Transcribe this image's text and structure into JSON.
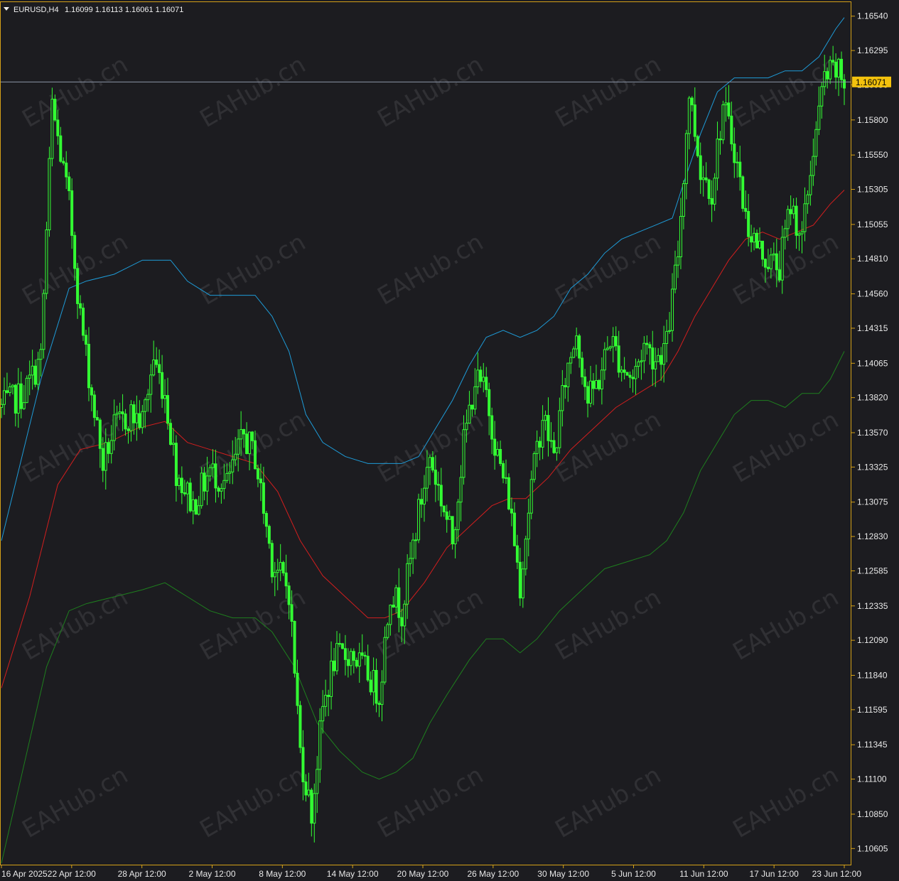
{
  "header": {
    "symbol": "EURUSD,H4",
    "ohlc": "1.16099 1.16113 1.16061 1.16071"
  },
  "current_price_label": "1.16071",
  "watermark_text": "EAHub.cn",
  "colors": {
    "background": "#1c1c20",
    "frame": "#d4a017",
    "candle": "#33ff33",
    "upper_band": "#1e9bd7",
    "middle_band": "#d21e1e",
    "lower_band": "#1e7f1e",
    "price_line": "#8a94a6",
    "price_tag": "#f4c20d"
  },
  "chart_data": {
    "type": "candlestick",
    "symbol": "EURUSD",
    "timeframe": "H4",
    "ylim": [
      1.1049,
      1.1664
    ],
    "y_ticks": [
      "1.16540",
      "1.16295",
      "1.16050",
      "1.15800",
      "1.15550",
      "1.15305",
      "1.15055",
      "1.14810",
      "1.14560",
      "1.14315",
      "1.14065",
      "1.13820",
      "1.13570",
      "1.13325",
      "1.13075",
      "1.12830",
      "1.12585",
      "1.12335",
      "1.12090",
      "1.11840",
      "1.11595",
      "1.11345",
      "1.11100",
      "1.10850",
      "1.10605"
    ],
    "x_ticks": [
      "16 Apr 2025",
      "22 Apr 12:00",
      "28 Apr 12:00",
      "2 May 12:00",
      "8 May 12:00",
      "14 May 12:00",
      "20 May 12:00",
      "26 May 12:00",
      "30 May 12:00",
      "5 Jun 12:00",
      "11 Jun 12:00",
      "17 Jun 12:00",
      "23 Jun 12:00"
    ],
    "current_price": 1.16071,
    "close_path": [
      {
        "bar": 0,
        "price": 1.1375
      },
      {
        "bar": 8,
        "price": 1.1385
      },
      {
        "bar": 14,
        "price": 1.141
      },
      {
        "bar": 18,
        "price": 1.159
      },
      {
        "bar": 24,
        "price": 1.152
      },
      {
        "bar": 28,
        "price": 1.144
      },
      {
        "bar": 32,
        "price": 1.1385
      },
      {
        "bar": 36,
        "price": 1.1335
      },
      {
        "bar": 40,
        "price": 1.136
      },
      {
        "bar": 46,
        "price": 1.137
      },
      {
        "bar": 50,
        "price": 1.1365
      },
      {
        "bar": 54,
        "price": 1.141
      },
      {
        "bar": 58,
        "price": 1.1385
      },
      {
        "bar": 62,
        "price": 1.133
      },
      {
        "bar": 68,
        "price": 1.1305
      },
      {
        "bar": 74,
        "price": 1.133
      },
      {
        "bar": 80,
        "price": 1.132
      },
      {
        "bar": 86,
        "price": 1.1355
      },
      {
        "bar": 90,
        "price": 1.134
      },
      {
        "bar": 96,
        "price": 1.1265
      },
      {
        "bar": 102,
        "price": 1.1245
      },
      {
        "bar": 106,
        "price": 1.113
      },
      {
        "bar": 110,
        "price": 1.1085
      },
      {
        "bar": 114,
        "price": 1.116
      },
      {
        "bar": 118,
        "price": 1.1195
      },
      {
        "bar": 124,
        "price": 1.12
      },
      {
        "bar": 130,
        "price": 1.1185
      },
      {
        "bar": 134,
        "price": 1.117
      },
      {
        "bar": 138,
        "price": 1.1245
      },
      {
        "bar": 142,
        "price": 1.123
      },
      {
        "bar": 148,
        "price": 1.13
      },
      {
        "bar": 152,
        "price": 1.134
      },
      {
        "bar": 156,
        "price": 1.131
      },
      {
        "bar": 160,
        "price": 1.128
      },
      {
        "bar": 164,
        "price": 1.135
      },
      {
        "bar": 168,
        "price": 1.1395
      },
      {
        "bar": 172,
        "price": 1.1385
      },
      {
        "bar": 176,
        "price": 1.134
      },
      {
        "bar": 180,
        "price": 1.131
      },
      {
        "bar": 184,
        "price": 1.125
      },
      {
        "bar": 188,
        "price": 1.132
      },
      {
        "bar": 192,
        "price": 1.137
      },
      {
        "bar": 196,
        "price": 1.134
      },
      {
        "bar": 200,
        "price": 1.1395
      },
      {
        "bar": 204,
        "price": 1.143
      },
      {
        "bar": 208,
        "price": 1.138
      },
      {
        "bar": 212,
        "price": 1.1395
      },
      {
        "bar": 216,
        "price": 1.1425
      },
      {
        "bar": 220,
        "price": 1.1405
      },
      {
        "bar": 224,
        "price": 1.1395
      },
      {
        "bar": 228,
        "price": 1.142
      },
      {
        "bar": 232,
        "price": 1.141
      },
      {
        "bar": 236,
        "price": 1.142
      },
      {
        "bar": 240,
        "price": 1.1485
      },
      {
        "bar": 244,
        "price": 1.16
      },
      {
        "bar": 248,
        "price": 1.1545
      },
      {
        "bar": 252,
        "price": 1.153
      },
      {
        "bar": 256,
        "price": 1.159
      },
      {
        "bar": 260,
        "price": 1.156
      },
      {
        "bar": 264,
        "price": 1.151
      },
      {
        "bar": 268,
        "price": 1.149
      },
      {
        "bar": 272,
        "price": 1.148
      },
      {
        "bar": 276,
        "price": 1.1475
      },
      {
        "bar": 280,
        "price": 1.152
      },
      {
        "bar": 284,
        "price": 1.1495
      },
      {
        "bar": 288,
        "price": 1.156
      },
      {
        "bar": 292,
        "price": 1.161
      },
      {
        "bar": 296,
        "price": 1.1615
      },
      {
        "bar": 299,
        "price": 1.16071
      }
    ],
    "upper_band": [
      {
        "bar": 0,
        "price": 1.128
      },
      {
        "bar": 14,
        "price": 1.1395
      },
      {
        "bar": 24,
        "price": 1.146
      },
      {
        "bar": 30,
        "price": 1.1465
      },
      {
        "bar": 40,
        "price": 1.147
      },
      {
        "bar": 50,
        "price": 1.148
      },
      {
        "bar": 60,
        "price": 1.148
      },
      {
        "bar": 66,
        "price": 1.1465
      },
      {
        "bar": 74,
        "price": 1.1455
      },
      {
        "bar": 82,
        "price": 1.1455
      },
      {
        "bar": 90,
        "price": 1.1455
      },
      {
        "bar": 96,
        "price": 1.144
      },
      {
        "bar": 102,
        "price": 1.1415
      },
      {
        "bar": 108,
        "price": 1.137
      },
      {
        "bar": 114,
        "price": 1.135
      },
      {
        "bar": 122,
        "price": 1.134
      },
      {
        "bar": 130,
        "price": 1.1335
      },
      {
        "bar": 136,
        "price": 1.1335
      },
      {
        "bar": 142,
        "price": 1.1335
      },
      {
        "bar": 148,
        "price": 1.134
      },
      {
        "bar": 154,
        "price": 1.136
      },
      {
        "bar": 160,
        "price": 1.138
      },
      {
        "bar": 166,
        "price": 1.1405
      },
      {
        "bar": 172,
        "price": 1.1425
      },
      {
        "bar": 178,
        "price": 1.143
      },
      {
        "bar": 184,
        "price": 1.1425
      },
      {
        "bar": 190,
        "price": 1.143
      },
      {
        "bar": 196,
        "price": 1.144
      },
      {
        "bar": 202,
        "price": 1.146
      },
      {
        "bar": 208,
        "price": 1.147
      },
      {
        "bar": 214,
        "price": 1.1485
      },
      {
        "bar": 220,
        "price": 1.1495
      },
      {
        "bar": 226,
        "price": 1.15
      },
      {
        "bar": 232,
        "price": 1.1505
      },
      {
        "bar": 238,
        "price": 1.151
      },
      {
        "bar": 242,
        "price": 1.1535
      },
      {
        "bar": 248,
        "price": 1.157
      },
      {
        "bar": 254,
        "price": 1.16
      },
      {
        "bar": 260,
        "price": 1.161
      },
      {
        "bar": 266,
        "price": 1.161
      },
      {
        "bar": 272,
        "price": 1.161
      },
      {
        "bar": 278,
        "price": 1.1615
      },
      {
        "bar": 284,
        "price": 1.1615
      },
      {
        "bar": 290,
        "price": 1.1625
      },
      {
        "bar": 296,
        "price": 1.1645
      },
      {
        "bar": 299,
        "price": 1.1653
      }
    ],
    "middle_band": [
      {
        "bar": 0,
        "price": 1.1175
      },
      {
        "bar": 10,
        "price": 1.124
      },
      {
        "bar": 20,
        "price": 1.132
      },
      {
        "bar": 28,
        "price": 1.1345
      },
      {
        "bar": 38,
        "price": 1.135
      },
      {
        "bar": 48,
        "price": 1.136
      },
      {
        "bar": 58,
        "price": 1.1365
      },
      {
        "bar": 66,
        "price": 1.135
      },
      {
        "bar": 74,
        "price": 1.1345
      },
      {
        "bar": 82,
        "price": 1.134
      },
      {
        "bar": 90,
        "price": 1.1335
      },
      {
        "bar": 98,
        "price": 1.1315
      },
      {
        "bar": 106,
        "price": 1.128
      },
      {
        "bar": 114,
        "price": 1.1255
      },
      {
        "bar": 122,
        "price": 1.124
      },
      {
        "bar": 130,
        "price": 1.1225
      },
      {
        "bar": 136,
        "price": 1.1225
      },
      {
        "bar": 142,
        "price": 1.123
      },
      {
        "bar": 150,
        "price": 1.125
      },
      {
        "bar": 158,
        "price": 1.1275
      },
      {
        "bar": 166,
        "price": 1.129
      },
      {
        "bar": 174,
        "price": 1.1305
      },
      {
        "bar": 180,
        "price": 1.131
      },
      {
        "bar": 186,
        "price": 1.131
      },
      {
        "bar": 194,
        "price": 1.1325
      },
      {
        "bar": 202,
        "price": 1.1345
      },
      {
        "bar": 210,
        "price": 1.136
      },
      {
        "bar": 218,
        "price": 1.1375
      },
      {
        "bar": 226,
        "price": 1.1385
      },
      {
        "bar": 234,
        "price": 1.1395
      },
      {
        "bar": 240,
        "price": 1.1415
      },
      {
        "bar": 246,
        "price": 1.144
      },
      {
        "bar": 252,
        "price": 1.146
      },
      {
        "bar": 258,
        "price": 1.148
      },
      {
        "bar": 264,
        "price": 1.1495
      },
      {
        "bar": 270,
        "price": 1.15
      },
      {
        "bar": 276,
        "price": 1.1495
      },
      {
        "bar": 282,
        "price": 1.15
      },
      {
        "bar": 288,
        "price": 1.1505
      },
      {
        "bar": 294,
        "price": 1.152
      },
      {
        "bar": 299,
        "price": 1.153
      }
    ],
    "lower_band": [
      {
        "bar": 0,
        "price": 1.105
      },
      {
        "bar": 8,
        "price": 1.112
      },
      {
        "bar": 16,
        "price": 1.119
      },
      {
        "bar": 24,
        "price": 1.123
      },
      {
        "bar": 30,
        "price": 1.1235
      },
      {
        "bar": 40,
        "price": 1.124
      },
      {
        "bar": 50,
        "price": 1.1245
      },
      {
        "bar": 58,
        "price": 1.125
      },
      {
        "bar": 66,
        "price": 1.124
      },
      {
        "bar": 74,
        "price": 1.123
      },
      {
        "bar": 82,
        "price": 1.1225
      },
      {
        "bar": 90,
        "price": 1.1225
      },
      {
        "bar": 96,
        "price": 1.1215
      },
      {
        "bar": 104,
        "price": 1.119
      },
      {
        "bar": 112,
        "price": 1.115
      },
      {
        "bar": 120,
        "price": 1.113
      },
      {
        "bar": 128,
        "price": 1.1115
      },
      {
        "bar": 134,
        "price": 1.111
      },
      {
        "bar": 140,
        "price": 1.1115
      },
      {
        "bar": 146,
        "price": 1.1125
      },
      {
        "bar": 152,
        "price": 1.115
      },
      {
        "bar": 158,
        "price": 1.117
      },
      {
        "bar": 166,
        "price": 1.1195
      },
      {
        "bar": 172,
        "price": 1.121
      },
      {
        "bar": 178,
        "price": 1.121
      },
      {
        "bar": 184,
        "price": 1.12
      },
      {
        "bar": 190,
        "price": 1.121
      },
      {
        "bar": 198,
        "price": 1.123
      },
      {
        "bar": 206,
        "price": 1.1245
      },
      {
        "bar": 214,
        "price": 1.126
      },
      {
        "bar": 222,
        "price": 1.1265
      },
      {
        "bar": 230,
        "price": 1.127
      },
      {
        "bar": 236,
        "price": 1.128
      },
      {
        "bar": 242,
        "price": 1.13
      },
      {
        "bar": 248,
        "price": 1.133
      },
      {
        "bar": 254,
        "price": 1.135
      },
      {
        "bar": 260,
        "price": 1.137
      },
      {
        "bar": 266,
        "price": 1.138
      },
      {
        "bar": 272,
        "price": 1.138
      },
      {
        "bar": 278,
        "price": 1.1375
      },
      {
        "bar": 284,
        "price": 1.1385
      },
      {
        "bar": 290,
        "price": 1.1385
      },
      {
        "bar": 294,
        "price": 1.1395
      },
      {
        "bar": 299,
        "price": 1.1415
      }
    ]
  }
}
